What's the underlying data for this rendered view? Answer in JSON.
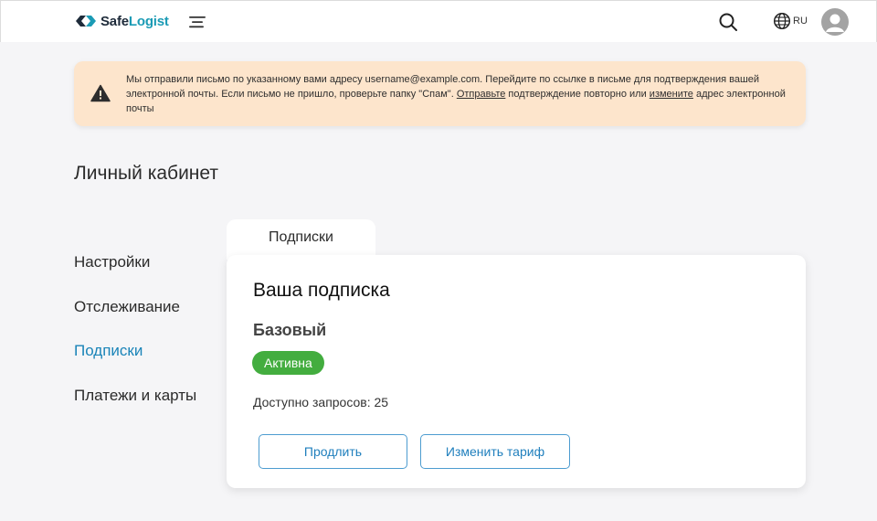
{
  "header": {
    "logo_part1": "Safe",
    "logo_part2": "Logist",
    "language": "RU",
    "icons": [
      "menu-icon",
      "search-icon",
      "globe-icon",
      "user-icon"
    ]
  },
  "alert": {
    "text_1": "Мы отправили письмо по указанному вами адресу username@example.com. Перейдите по ссылке в письме для подтверждения вашей электронной почты. Если письмо не пришло, проверьте папку \"Спам\". ",
    "link_resend": "Отправьте",
    "text_2": " подтверждение повторно или ",
    "link_change": "измените",
    "text_3": " адрес электронной почты",
    "icon": "warning-icon"
  },
  "page": {
    "title": "Личный кабинет"
  },
  "sidebar": {
    "items": [
      {
        "label": "Настройки"
      },
      {
        "label": "Отслеживание"
      },
      {
        "label": "Подписки"
      },
      {
        "label": "Платежи и карты"
      }
    ],
    "active_index": 2
  },
  "tabs": [
    {
      "label": "Подписки"
    }
  ],
  "subscription": {
    "title": "Ваша подписка",
    "plan": "Базовый",
    "status": "Активна",
    "requests_label": "Доступно запросов: 25",
    "renew_label": "Продлить",
    "change_label": "Изменить тариф"
  },
  "colors": {
    "brand_dark": "#1e2b3a",
    "brand_accent": "#1b9bb5",
    "alert_bg": "#fde5cc",
    "active_link": "#1a84b8",
    "status_green": "#43ad3f",
    "button_border": "#4d9cd0"
  }
}
